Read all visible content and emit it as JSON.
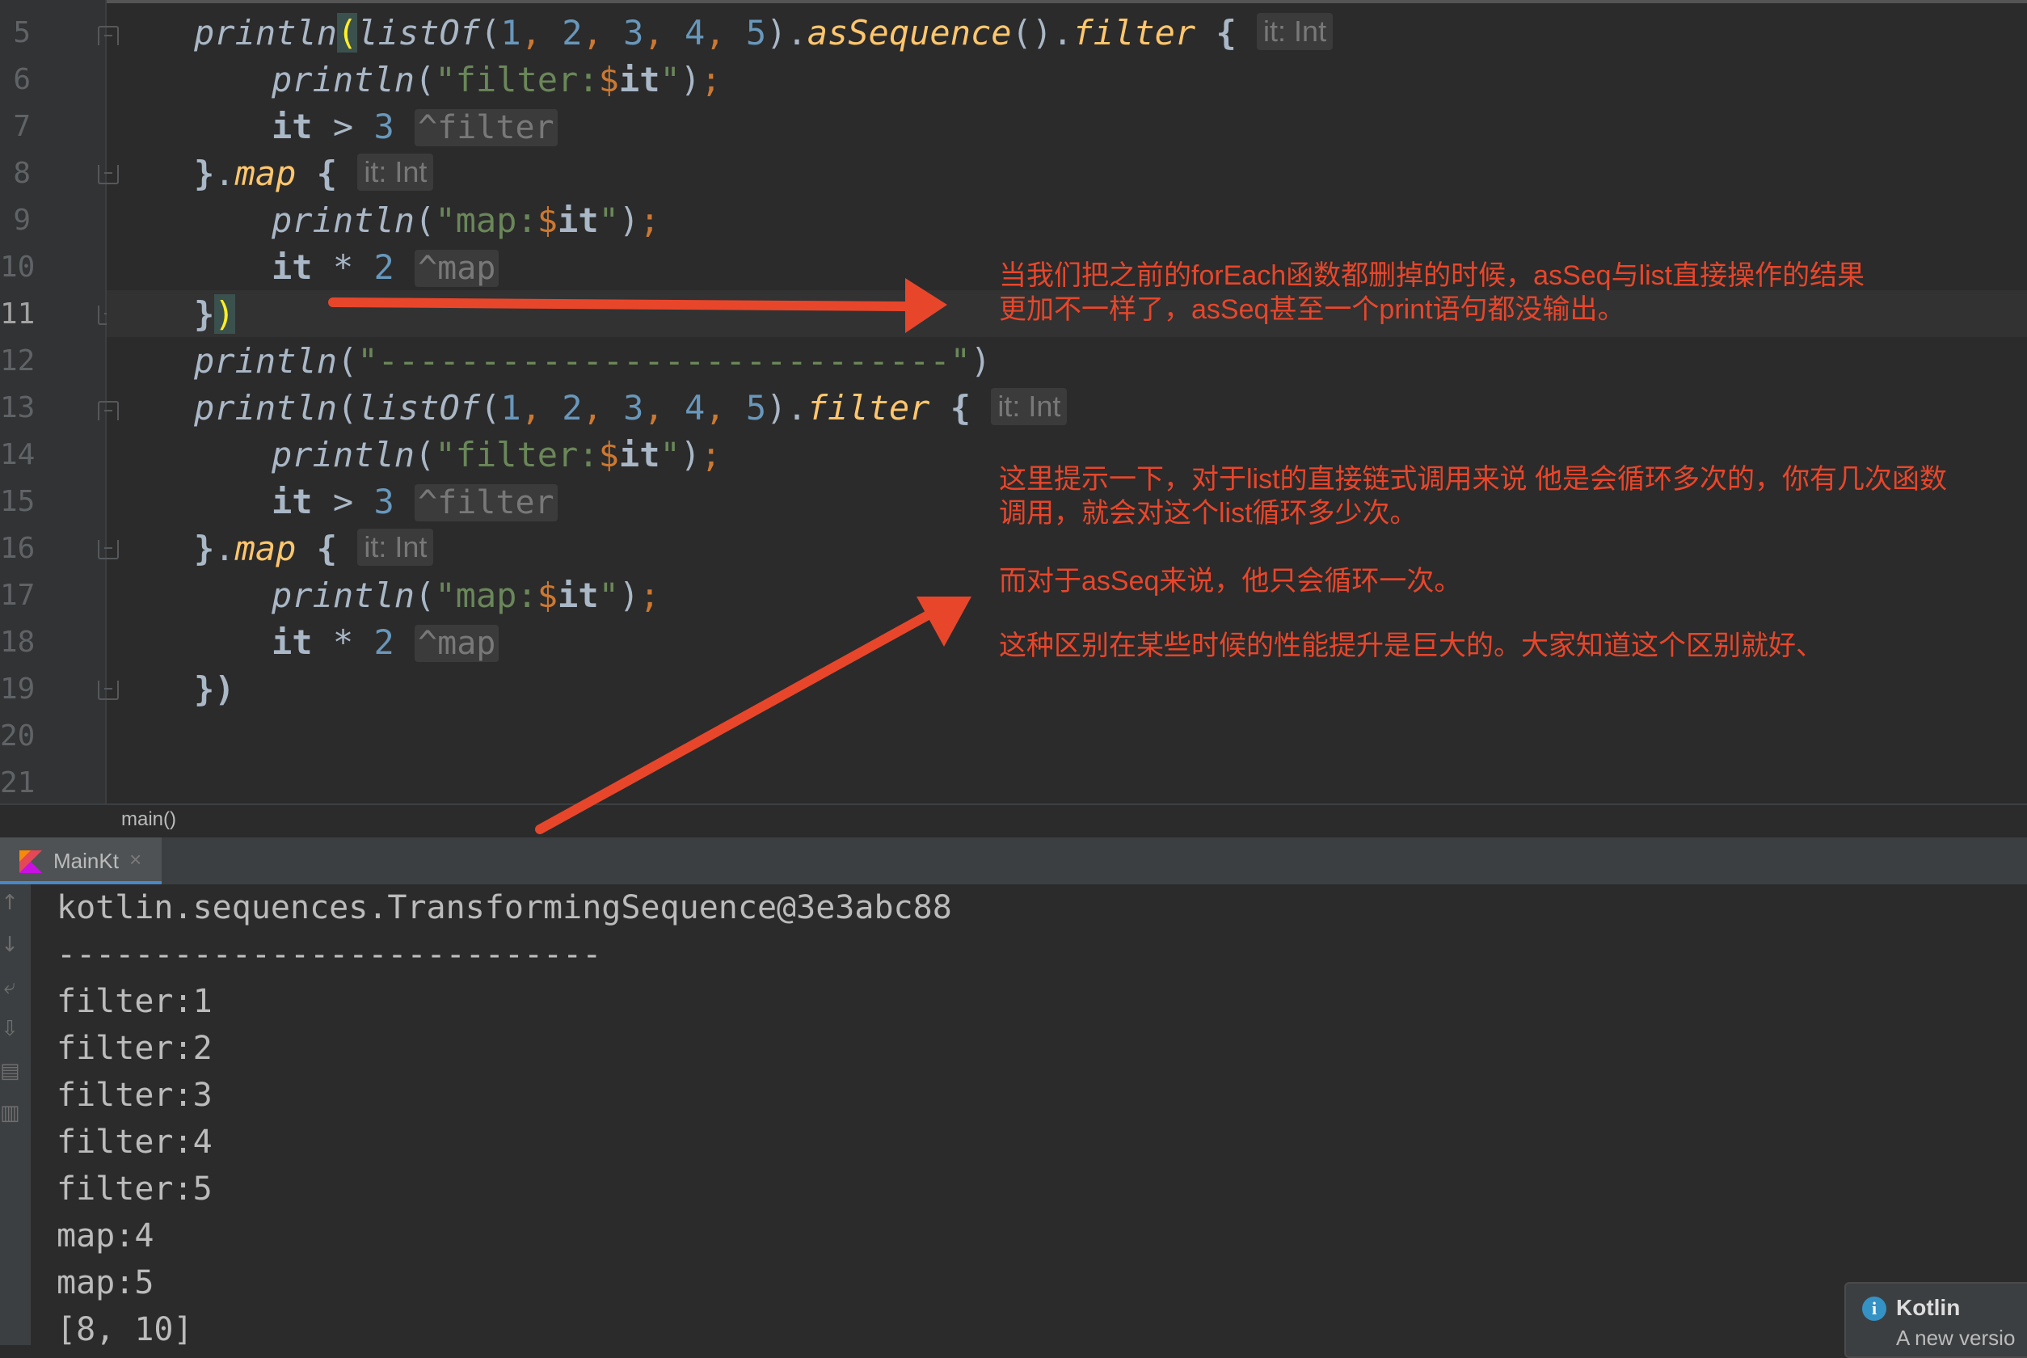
{
  "editor": {
    "line_numbers": [
      "5",
      "6",
      "7",
      "8",
      "9",
      "10",
      "11",
      "12",
      "13",
      "14",
      "15",
      "16",
      "17",
      "18",
      "19",
      "20",
      "21"
    ],
    "current_line": "11",
    "code": {
      "println": "println",
      "listOf": "listOf",
      "asSequence": "asSequence",
      "filter": "filter",
      "map": "map",
      "it": "it",
      "str_filter_prefix": "\"filter:",
      "str_map_prefix": "\"map:",
      "str_dollar": "$",
      "str_quote": "\"",
      "str_dashes": "\"----------------------------\"",
      "hint_it_int": "it: Int",
      "hint_filter": "^filter",
      "hint_map": "^map",
      "n1": "1",
      "n2": "2",
      "n3": "3",
      "n4": "4",
      "n5": "5"
    },
    "breadcrumb": "main()"
  },
  "annotations": {
    "note1_line1": "当我们把之前的forEach函数都删掉的时候，asSeq与list直接操作的结果",
    "note1_line2": "更加不一样了，asSeq甚至一个print语句都没输出。",
    "note2_line1": "这里提示一下，对于list的直接链式调用来说 他是会循环多次的，你有几次函数",
    "note2_line2": "调用，就会对这个list循环多少次。",
    "note3": "而对于asSeq来说，他只会循环一次。",
    "note4": "这种区别在某些时候的性能提升是巨大的。大家知道这个区别就好、"
  },
  "run_panel": {
    "tab_label": "MainKt",
    "tab_close": "×",
    "output": [
      "kotlin.sequences.TransformingSequence@3e3abc88",
      "----------------------------",
      "filter:1",
      "filter:2",
      "filter:3",
      "filter:4",
      "filter:5",
      "map:4",
      "map:5",
      "[8, 10]"
    ]
  },
  "notification": {
    "title": "Kotlin",
    "text": "A new versio"
  },
  "colors": {
    "annotation": "#e8462b",
    "background": "#2b2b2b"
  }
}
